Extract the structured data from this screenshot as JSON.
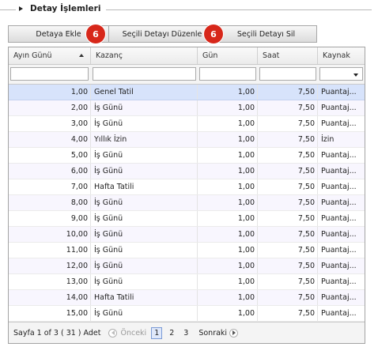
{
  "section": {
    "title": "Detay İşlemleri"
  },
  "toolbar": {
    "buttons": [
      "Detaya Ekle",
      "Seçili Detayı Düzenle",
      "Seçili Detayı Sil"
    ],
    "badge1": "6",
    "badge2": "6"
  },
  "columns": [
    "Ayın Günü",
    "Kazanç",
    "Gün",
    "Saat",
    "Kaynak"
  ],
  "rows": [
    [
      "1,00",
      "Genel Tatil",
      "1,00",
      "7,50",
      "Puantaj..."
    ],
    [
      "2,00",
      "İş Günü",
      "1,00",
      "7,50",
      "Puantaj..."
    ],
    [
      "3,00",
      "İş Günü",
      "1,00",
      "7,50",
      "Puantaj..."
    ],
    [
      "4,00",
      "Yıllık İzin",
      "1,00",
      "7,50",
      "İzin"
    ],
    [
      "5,00",
      "İş Günü",
      "1,00",
      "7,50",
      "Puantaj..."
    ],
    [
      "6,00",
      "İş Günü",
      "1,00",
      "7,50",
      "Puantaj..."
    ],
    [
      "7,00",
      "Hafta Tatili",
      "1,00",
      "7,50",
      "Puantaj..."
    ],
    [
      "8,00",
      "İş Günü",
      "1,00",
      "7,50",
      "Puantaj..."
    ],
    [
      "9,00",
      "İş Günü",
      "1,00",
      "7,50",
      "Puantaj..."
    ],
    [
      "10,00",
      "İş Günü",
      "1,00",
      "7,50",
      "Puantaj..."
    ],
    [
      "11,00",
      "İş Günü",
      "1,00",
      "7,50",
      "Puantaj..."
    ],
    [
      "12,00",
      "İş Günü",
      "1,00",
      "7,50",
      "Puantaj..."
    ],
    [
      "13,00",
      "İş Günü",
      "1,00",
      "7,50",
      "Puantaj..."
    ],
    [
      "14,00",
      "Hafta Tatili",
      "1,00",
      "7,50",
      "Puantaj..."
    ],
    [
      "15,00",
      "İş Günü",
      "1,00",
      "7,50",
      "Puantaj..."
    ]
  ],
  "pager": {
    "info": "Sayfa 1 of 3 ( 31 ) Adet",
    "prev": "Önceki",
    "pages": [
      "1",
      "2",
      "3"
    ],
    "next": "Sonraki"
  },
  "colors": {
    "selected_row": "#d7e3fb",
    "alt_row": "#f8f6fe",
    "badge": "#d7271a"
  }
}
